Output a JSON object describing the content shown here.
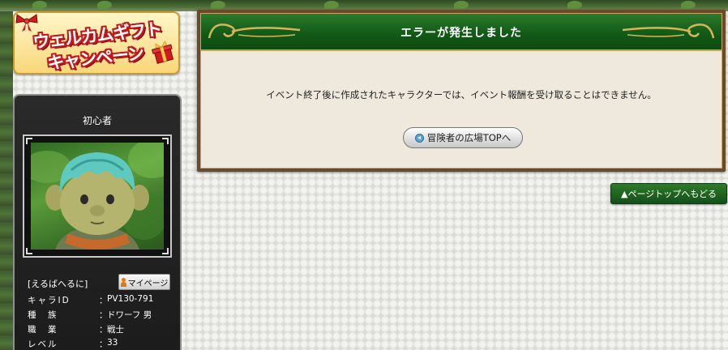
{
  "banner": {
    "line1": "ウェルカムギフト",
    "line2": "キャンペーン"
  },
  "character": {
    "title": "初心者",
    "name": "[えるばへるに]",
    "mypage_label": "マイページ",
    "info": [
      {
        "key": "キャラID",
        "sep": "：",
        "value": "PV130-791"
      },
      {
        "key": "種　族",
        "sep": "：",
        "value": "ドワーフ 男"
      },
      {
        "key": "職　業",
        "sep": "：",
        "value": "戦士"
      },
      {
        "key": "レベル",
        "sep": "：",
        "value": "33"
      }
    ]
  },
  "error": {
    "title": "エラーが発生しました",
    "message": "イベント終了後に作成されたキャラクターでは、イベント報酬を受け取ることはできません。",
    "top_button_label": "冒険者の広場TOPへ"
  },
  "pagetop_label": "▲ページトップへもどる",
  "colors": {
    "header_green": "#125a16",
    "panel_bg": "#efe9dd",
    "banner_red": "#c2181c"
  }
}
